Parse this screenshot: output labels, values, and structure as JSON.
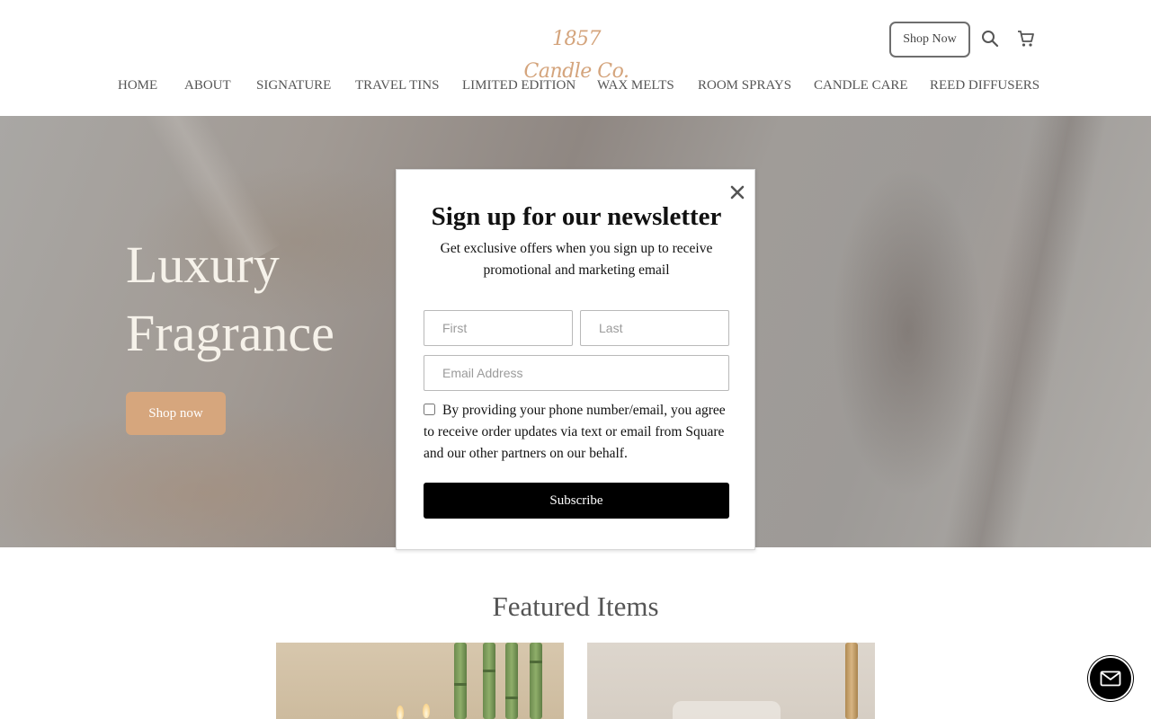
{
  "header": {
    "logo_text": "1857 Candle Co.",
    "shop_now_label": "Shop Now",
    "search_icon": "search-icon",
    "cart_icon": "cart-icon"
  },
  "nav": {
    "items": [
      {
        "label": "HOME"
      },
      {
        "label": "ABOUT"
      },
      {
        "label": "SIGNATURE"
      },
      {
        "label": "TRAVEL TINS"
      },
      {
        "label": "LIMITED EDITION"
      },
      {
        "label": "WAX MELTS"
      },
      {
        "label": "ROOM SPRAYS"
      },
      {
        "label": "CANDLE CARE"
      },
      {
        "label": "REED DIFFUSERS"
      }
    ]
  },
  "hero": {
    "title_line1": "Luxury",
    "title_line2": "Fragrance",
    "cta_label": "Shop now"
  },
  "modal": {
    "title": "Sign up for our newsletter",
    "subtitle": "Get exclusive offers when you sign up to receive promotional and marketing email",
    "first_placeholder": "First",
    "last_placeholder": "Last",
    "email_placeholder": "Email Address",
    "consent_text": "By providing your phone number/email, you agree to receive order updates via text or email from Square and our other partners on our behalf.",
    "consent_checked": false,
    "subscribe_label": "Subscribe",
    "close_icon": "close-icon"
  },
  "featured": {
    "title": "Featured Items"
  },
  "chat": {
    "icon": "mail-icon"
  },
  "colors": {
    "accent": "#d6a67d",
    "logo": "#d4a47c",
    "button_dark": "#000000"
  }
}
